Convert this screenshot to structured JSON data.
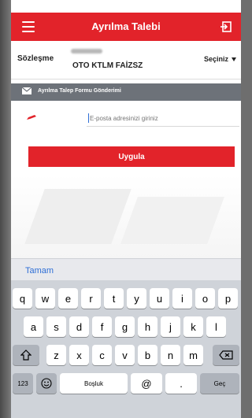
{
  "header": {
    "title": "Ayrılma Talebi",
    "menu_icon": "hamburger-menu-icon",
    "exit_icon": "logout-icon"
  },
  "contract": {
    "label": "Sözleşme",
    "value": "OTO KTLM FAİZSZ",
    "select_label": "Seçiniz"
  },
  "section": {
    "title": "Ayrılma Talep Formu Gönderimi"
  },
  "email": {
    "placeholder": "E-posta adresinizi giriniz",
    "value": ""
  },
  "apply_button": {
    "label": "Uygula"
  },
  "keyboard": {
    "done_label": "Tamam",
    "row1": [
      "q",
      "w",
      "e",
      "r",
      "t",
      "y",
      "u",
      "i",
      "o",
      "p"
    ],
    "row2": [
      "a",
      "s",
      "d",
      "f",
      "g",
      "h",
      "j",
      "k",
      "l"
    ],
    "row3": [
      "z",
      "x",
      "c",
      "v",
      "b",
      "n",
      "m"
    ],
    "numbers_label": "123",
    "space_label": "Boşluk",
    "at_label": "@",
    "dot_label": ".",
    "go_label": "Geç"
  },
  "colors": {
    "accent": "#e2232a",
    "section_bar": "#6d7279",
    "link": "#2f6fd6"
  }
}
